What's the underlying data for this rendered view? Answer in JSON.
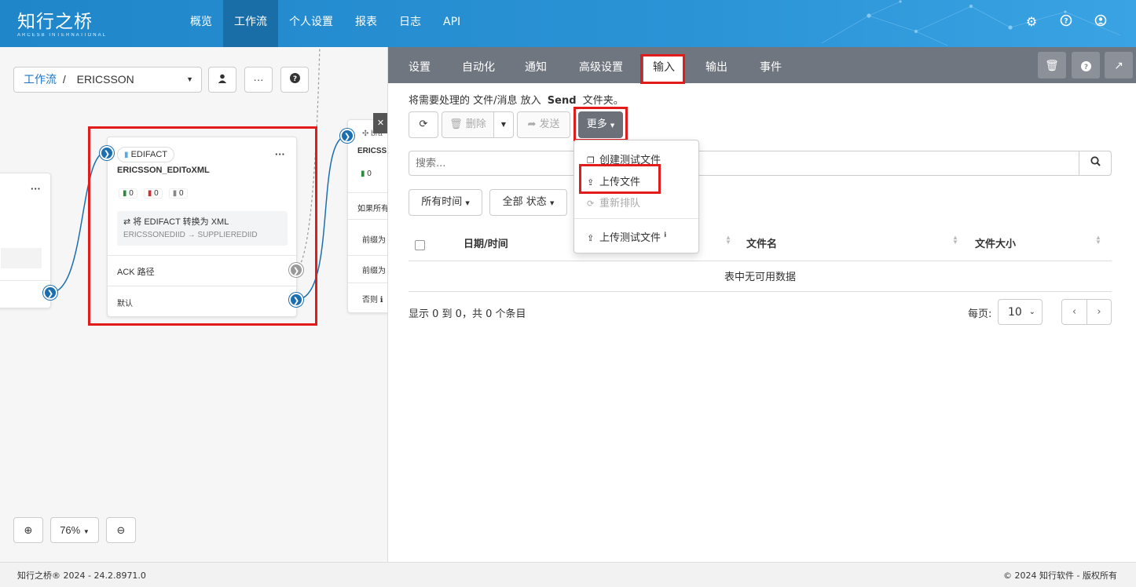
{
  "brand": {
    "name_cn": "知行之桥",
    "name_en": "ARCESB INTERNATIONAL"
  },
  "nav": {
    "items": [
      "概览",
      "工作流",
      "个人设置",
      "报表",
      "日志",
      "API"
    ],
    "active": "工作流"
  },
  "topicons": [
    "gear-icon",
    "help-icon",
    "user-icon"
  ],
  "canvas": {
    "breadcrumb_link": "工作流",
    "breadcrumb_sep": "/",
    "breadcrumb_current": "ERICSSON",
    "node": {
      "badge": "EDIFACT",
      "title": "ERICSSON_EDIToXML",
      "counts": [
        "0",
        "0",
        "0"
      ],
      "desc_line1": "将 EDIFACT 转换为 XML",
      "desc_line2": "ERICSSONEDIID → SUPPLIEREDIID",
      "path_ack": "ACK 路径",
      "path_default": "默认"
    },
    "node2": {
      "title": "ERICSS",
      "count": "0",
      "row1": "如果所有",
      "row2": "前缀为",
      "row3": "前缀为",
      "row4": "否则",
      "badge_partial": "bra"
    },
    "zoom": "76%"
  },
  "panel": {
    "tabs": [
      "设置",
      "自动化",
      "通知",
      "高级设置",
      "输入",
      "输出",
      "事件"
    ],
    "active_tab": "输入",
    "hint_prefix": "将需要处理的 文件/消息 放入",
    "hint_folder": "Send",
    "hint_suffix": "文件夹。",
    "btn_delete": "删除",
    "btn_send": "发送",
    "btn_more": "更多",
    "more_menu": [
      "创建测试文件",
      "上传文件",
      "重新排队",
      "上传测试文件"
    ],
    "search_placeholder": "搜索...",
    "filter_time": "所有时间",
    "filter_status": "全部 状态",
    "columns": [
      "日期/时间",
      "文件名",
      "文件大小"
    ],
    "empty": "表中无可用数据",
    "info": "显示 0 到 0，共 0 个条目",
    "per_page_label": "每页:",
    "per_page": "10"
  },
  "footer": {
    "left": "知行之桥® 2024 - 24.2.8971.0",
    "right": "© 2024 知行软件 - 版权所有"
  }
}
